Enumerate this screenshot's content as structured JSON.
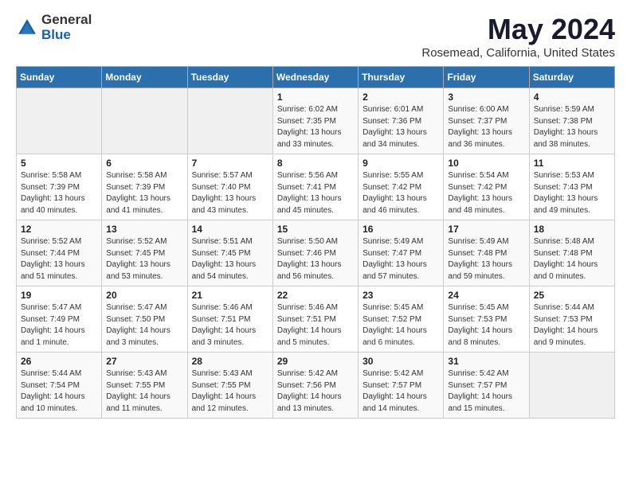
{
  "header": {
    "logo_general": "General",
    "logo_blue": "Blue",
    "title": "May 2024",
    "subtitle": "Rosemead, California, United States"
  },
  "days_of_week": [
    "Sunday",
    "Monday",
    "Tuesday",
    "Wednesday",
    "Thursday",
    "Friday",
    "Saturday"
  ],
  "weeks": [
    [
      {
        "day": "",
        "info": ""
      },
      {
        "day": "",
        "info": ""
      },
      {
        "day": "",
        "info": ""
      },
      {
        "day": "1",
        "info": "Sunrise: 6:02 AM\nSunset: 7:35 PM\nDaylight: 13 hours\nand 33 minutes."
      },
      {
        "day": "2",
        "info": "Sunrise: 6:01 AM\nSunset: 7:36 PM\nDaylight: 13 hours\nand 34 minutes."
      },
      {
        "day": "3",
        "info": "Sunrise: 6:00 AM\nSunset: 7:37 PM\nDaylight: 13 hours\nand 36 minutes."
      },
      {
        "day": "4",
        "info": "Sunrise: 5:59 AM\nSunset: 7:38 PM\nDaylight: 13 hours\nand 38 minutes."
      }
    ],
    [
      {
        "day": "5",
        "info": "Sunrise: 5:58 AM\nSunset: 7:39 PM\nDaylight: 13 hours\nand 40 minutes."
      },
      {
        "day": "6",
        "info": "Sunrise: 5:58 AM\nSunset: 7:39 PM\nDaylight: 13 hours\nand 41 minutes."
      },
      {
        "day": "7",
        "info": "Sunrise: 5:57 AM\nSunset: 7:40 PM\nDaylight: 13 hours\nand 43 minutes."
      },
      {
        "day": "8",
        "info": "Sunrise: 5:56 AM\nSunset: 7:41 PM\nDaylight: 13 hours\nand 45 minutes."
      },
      {
        "day": "9",
        "info": "Sunrise: 5:55 AM\nSunset: 7:42 PM\nDaylight: 13 hours\nand 46 minutes."
      },
      {
        "day": "10",
        "info": "Sunrise: 5:54 AM\nSunset: 7:42 PM\nDaylight: 13 hours\nand 48 minutes."
      },
      {
        "day": "11",
        "info": "Sunrise: 5:53 AM\nSunset: 7:43 PM\nDaylight: 13 hours\nand 49 minutes."
      }
    ],
    [
      {
        "day": "12",
        "info": "Sunrise: 5:52 AM\nSunset: 7:44 PM\nDaylight: 13 hours\nand 51 minutes."
      },
      {
        "day": "13",
        "info": "Sunrise: 5:52 AM\nSunset: 7:45 PM\nDaylight: 13 hours\nand 53 minutes."
      },
      {
        "day": "14",
        "info": "Sunrise: 5:51 AM\nSunset: 7:45 PM\nDaylight: 13 hours\nand 54 minutes."
      },
      {
        "day": "15",
        "info": "Sunrise: 5:50 AM\nSunset: 7:46 PM\nDaylight: 13 hours\nand 56 minutes."
      },
      {
        "day": "16",
        "info": "Sunrise: 5:49 AM\nSunset: 7:47 PM\nDaylight: 13 hours\nand 57 minutes."
      },
      {
        "day": "17",
        "info": "Sunrise: 5:49 AM\nSunset: 7:48 PM\nDaylight: 13 hours\nand 59 minutes."
      },
      {
        "day": "18",
        "info": "Sunrise: 5:48 AM\nSunset: 7:48 PM\nDaylight: 14 hours\nand 0 minutes."
      }
    ],
    [
      {
        "day": "19",
        "info": "Sunrise: 5:47 AM\nSunset: 7:49 PM\nDaylight: 14 hours\nand 1 minute."
      },
      {
        "day": "20",
        "info": "Sunrise: 5:47 AM\nSunset: 7:50 PM\nDaylight: 14 hours\nand 3 minutes."
      },
      {
        "day": "21",
        "info": "Sunrise: 5:46 AM\nSunset: 7:51 PM\nDaylight: 14 hours\nand 3 minutes."
      },
      {
        "day": "22",
        "info": "Sunrise: 5:46 AM\nSunset: 7:51 PM\nDaylight: 14 hours\nand 5 minutes."
      },
      {
        "day": "23",
        "info": "Sunrise: 5:45 AM\nSunset: 7:52 PM\nDaylight: 14 hours\nand 6 minutes."
      },
      {
        "day": "24",
        "info": "Sunrise: 5:45 AM\nSunset: 7:53 PM\nDaylight: 14 hours\nand 8 minutes."
      },
      {
        "day": "25",
        "info": "Sunrise: 5:44 AM\nSunset: 7:53 PM\nDaylight: 14 hours\nand 9 minutes."
      }
    ],
    [
      {
        "day": "26",
        "info": "Sunrise: 5:44 AM\nSunset: 7:54 PM\nDaylight: 14 hours\nand 10 minutes."
      },
      {
        "day": "27",
        "info": "Sunrise: 5:43 AM\nSunset: 7:55 PM\nDaylight: 14 hours\nand 11 minutes."
      },
      {
        "day": "28",
        "info": "Sunrise: 5:43 AM\nSunset: 7:55 PM\nDaylight: 14 hours\nand 12 minutes."
      },
      {
        "day": "29",
        "info": "Sunrise: 5:42 AM\nSunset: 7:56 PM\nDaylight: 14 hours\nand 13 minutes."
      },
      {
        "day": "30",
        "info": "Sunrise: 5:42 AM\nSunset: 7:57 PM\nDaylight: 14 hours\nand 14 minutes."
      },
      {
        "day": "31",
        "info": "Sunrise: 5:42 AM\nSunset: 7:57 PM\nDaylight: 14 hours\nand 15 minutes."
      },
      {
        "day": "",
        "info": ""
      }
    ]
  ]
}
